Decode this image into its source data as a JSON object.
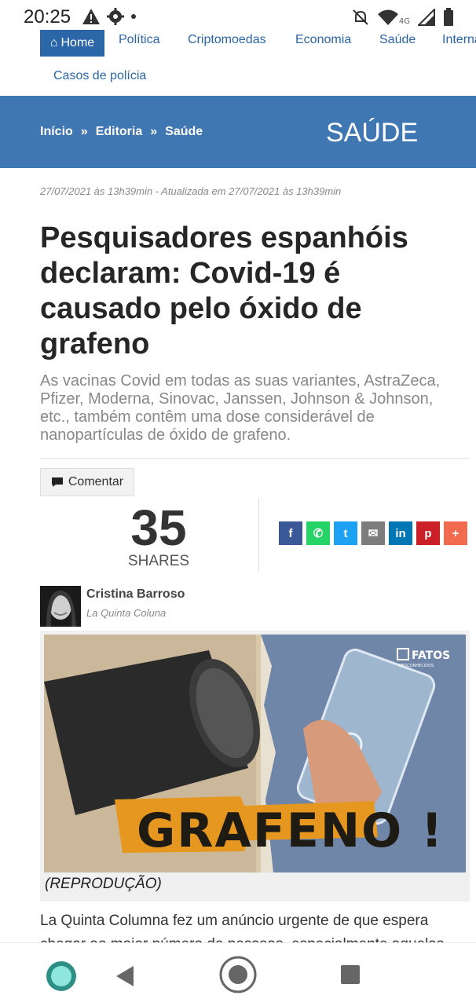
{
  "status_bar": {
    "time": "20:25",
    "network": "4G"
  },
  "top_nav": {
    "home": "Home",
    "links": [
      "Política",
      "Criptomoedas",
      "Economia",
      "Saúde",
      "Interna"
    ],
    "links_row2": [
      "Casos de polícia"
    ]
  },
  "breadcrumb": {
    "items": [
      "Início",
      "Editoria",
      "Saúde"
    ],
    "section_title": "SAÚDE"
  },
  "article": {
    "dateline": "27/07/2021 às 13h39min - Atualizada em 27/07/2021 às 13h39min",
    "title": "Pesquisadores espanhóis declaram: Covid-19 é causado pelo óxido de grafeno",
    "subtitle": "As vacinas Covid em todas as suas variantes, AstraZeca, Pfizer, Moderna, Sinovac, Janssen, Johnson & Johnson, etc., também contêm uma dose considerável de nanopartículas de óxido de grafeno.",
    "comment_label": "Comentar",
    "shares_count": "35",
    "shares_label": "SHARES",
    "author_name": "Cristina Barroso",
    "author_source": "La Quinta Coluna",
    "image_word": "GRAFENO !",
    "image_logo": "FATOS",
    "image_logo_sub": "DESCONHECIDOS",
    "caption": "(REPRODUÇÃO)",
    "body_start": "La Quinta Columna fez um anúncio urgente de que espera chegar ao maior número de pessoas, especialmente aquelas"
  },
  "social_buttons": [
    {
      "icon": "facebook-icon",
      "glyph": "f",
      "color": "#3b5998"
    },
    {
      "icon": "whatsapp-icon",
      "glyph": "✆",
      "color": "#25d366"
    },
    {
      "icon": "twitter-icon",
      "glyph": "t",
      "color": "#1da1f2"
    },
    {
      "icon": "email-icon",
      "glyph": "✉",
      "color": "#7d7d7d"
    },
    {
      "icon": "linkedin-icon",
      "glyph": "in",
      "color": "#0077b5"
    },
    {
      "icon": "pinterest-icon",
      "glyph": "p",
      "color": "#cb2027"
    },
    {
      "icon": "more-share-icon",
      "glyph": "+",
      "color": "#f26b4f"
    }
  ],
  "colors": {
    "nav_blue": "#2b66a9",
    "banner_blue": "#3f77b2"
  }
}
